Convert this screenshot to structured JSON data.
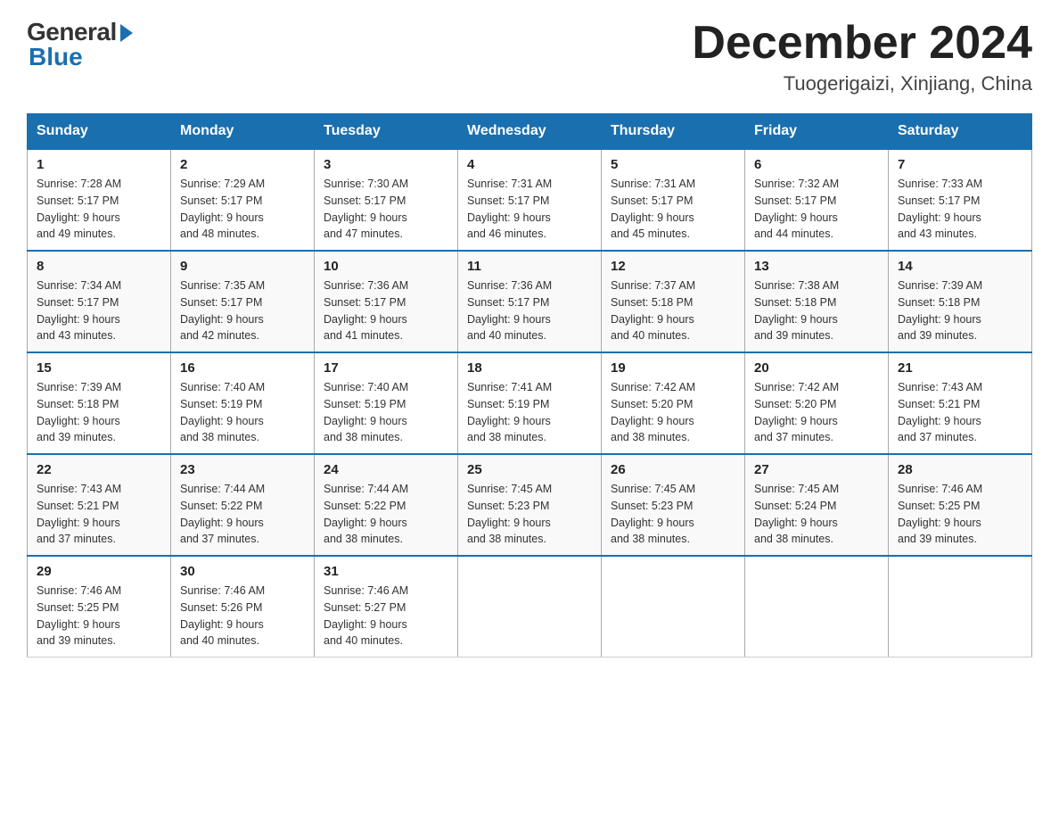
{
  "logo": {
    "general": "General",
    "blue": "Blue"
  },
  "title": {
    "month": "December 2024",
    "location": "Tuogerigaizi, Xinjiang, China"
  },
  "headers": [
    "Sunday",
    "Monday",
    "Tuesday",
    "Wednesday",
    "Thursday",
    "Friday",
    "Saturday"
  ],
  "weeks": [
    [
      {
        "day": "1",
        "sunrise": "7:28 AM",
        "sunset": "5:17 PM",
        "daylight": "9 hours and 49 minutes."
      },
      {
        "day": "2",
        "sunrise": "7:29 AM",
        "sunset": "5:17 PM",
        "daylight": "9 hours and 48 minutes."
      },
      {
        "day": "3",
        "sunrise": "7:30 AM",
        "sunset": "5:17 PM",
        "daylight": "9 hours and 47 minutes."
      },
      {
        "day": "4",
        "sunrise": "7:31 AM",
        "sunset": "5:17 PM",
        "daylight": "9 hours and 46 minutes."
      },
      {
        "day": "5",
        "sunrise": "7:31 AM",
        "sunset": "5:17 PM",
        "daylight": "9 hours and 45 minutes."
      },
      {
        "day": "6",
        "sunrise": "7:32 AM",
        "sunset": "5:17 PM",
        "daylight": "9 hours and 44 minutes."
      },
      {
        "day": "7",
        "sunrise": "7:33 AM",
        "sunset": "5:17 PM",
        "daylight": "9 hours and 43 minutes."
      }
    ],
    [
      {
        "day": "8",
        "sunrise": "7:34 AM",
        "sunset": "5:17 PM",
        "daylight": "9 hours and 43 minutes."
      },
      {
        "day": "9",
        "sunrise": "7:35 AM",
        "sunset": "5:17 PM",
        "daylight": "9 hours and 42 minutes."
      },
      {
        "day": "10",
        "sunrise": "7:36 AM",
        "sunset": "5:17 PM",
        "daylight": "9 hours and 41 minutes."
      },
      {
        "day": "11",
        "sunrise": "7:36 AM",
        "sunset": "5:17 PM",
        "daylight": "9 hours and 40 minutes."
      },
      {
        "day": "12",
        "sunrise": "7:37 AM",
        "sunset": "5:18 PM",
        "daylight": "9 hours and 40 minutes."
      },
      {
        "day": "13",
        "sunrise": "7:38 AM",
        "sunset": "5:18 PM",
        "daylight": "9 hours and 39 minutes."
      },
      {
        "day": "14",
        "sunrise": "7:39 AM",
        "sunset": "5:18 PM",
        "daylight": "9 hours and 39 minutes."
      }
    ],
    [
      {
        "day": "15",
        "sunrise": "7:39 AM",
        "sunset": "5:18 PM",
        "daylight": "9 hours and 39 minutes."
      },
      {
        "day": "16",
        "sunrise": "7:40 AM",
        "sunset": "5:19 PM",
        "daylight": "9 hours and 38 minutes."
      },
      {
        "day": "17",
        "sunrise": "7:40 AM",
        "sunset": "5:19 PM",
        "daylight": "9 hours and 38 minutes."
      },
      {
        "day": "18",
        "sunrise": "7:41 AM",
        "sunset": "5:19 PM",
        "daylight": "9 hours and 38 minutes."
      },
      {
        "day": "19",
        "sunrise": "7:42 AM",
        "sunset": "5:20 PM",
        "daylight": "9 hours and 38 minutes."
      },
      {
        "day": "20",
        "sunrise": "7:42 AM",
        "sunset": "5:20 PM",
        "daylight": "9 hours and 37 minutes."
      },
      {
        "day": "21",
        "sunrise": "7:43 AM",
        "sunset": "5:21 PM",
        "daylight": "9 hours and 37 minutes."
      }
    ],
    [
      {
        "day": "22",
        "sunrise": "7:43 AM",
        "sunset": "5:21 PM",
        "daylight": "9 hours and 37 minutes."
      },
      {
        "day": "23",
        "sunrise": "7:44 AM",
        "sunset": "5:22 PM",
        "daylight": "9 hours and 37 minutes."
      },
      {
        "day": "24",
        "sunrise": "7:44 AM",
        "sunset": "5:22 PM",
        "daylight": "9 hours and 38 minutes."
      },
      {
        "day": "25",
        "sunrise": "7:45 AM",
        "sunset": "5:23 PM",
        "daylight": "9 hours and 38 minutes."
      },
      {
        "day": "26",
        "sunrise": "7:45 AM",
        "sunset": "5:23 PM",
        "daylight": "9 hours and 38 minutes."
      },
      {
        "day": "27",
        "sunrise": "7:45 AM",
        "sunset": "5:24 PM",
        "daylight": "9 hours and 38 minutes."
      },
      {
        "day": "28",
        "sunrise": "7:46 AM",
        "sunset": "5:25 PM",
        "daylight": "9 hours and 39 minutes."
      }
    ],
    [
      {
        "day": "29",
        "sunrise": "7:46 AM",
        "sunset": "5:25 PM",
        "daylight": "9 hours and 39 minutes."
      },
      {
        "day": "30",
        "sunrise": "7:46 AM",
        "sunset": "5:26 PM",
        "daylight": "9 hours and 40 minutes."
      },
      {
        "day": "31",
        "sunrise": "7:46 AM",
        "sunset": "5:27 PM",
        "daylight": "9 hours and 40 minutes."
      },
      null,
      null,
      null,
      null
    ]
  ]
}
